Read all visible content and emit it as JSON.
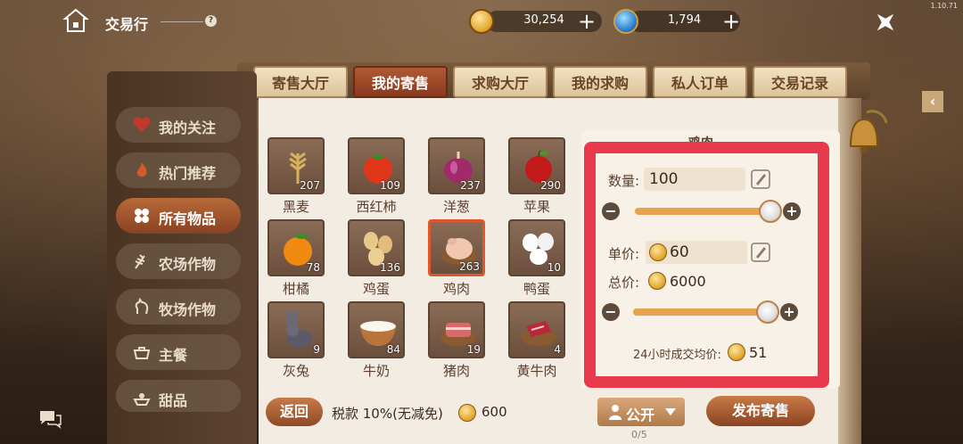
{
  "version": "1.10.71",
  "header": {
    "title": "交易行",
    "help": "?",
    "gold": {
      "amount": "30,254",
      "add": "+"
    },
    "gem": {
      "amount": "1,794",
      "add": "+"
    }
  },
  "tabs": [
    {
      "label": "寄售大厅"
    },
    {
      "label": "我的寄售"
    },
    {
      "label": "求购大厅"
    },
    {
      "label": "我的求购"
    },
    {
      "label": "私人订单"
    },
    {
      "label": "交易记录"
    }
  ],
  "categories": [
    {
      "label": "我的关注"
    },
    {
      "label": "热门推荐"
    },
    {
      "label": "所有物品"
    },
    {
      "label": "农场作物"
    },
    {
      "label": "牧场作物"
    },
    {
      "label": "主餐"
    },
    {
      "label": "甜品"
    }
  ],
  "items": [
    {
      "name": "黑麦",
      "count": "207"
    },
    {
      "name": "西红柿",
      "count": "109"
    },
    {
      "name": "洋葱",
      "count": "237"
    },
    {
      "name": "苹果",
      "count": "290"
    },
    {
      "name": "柑橘",
      "count": "78"
    },
    {
      "name": "鸡蛋",
      "count": "136"
    },
    {
      "name": "鸡肉",
      "count": "263"
    },
    {
      "name": "鸭蛋",
      "count": "10"
    },
    {
      "name": "灰兔",
      "count": "9"
    },
    {
      "name": "牛奶",
      "count": "84"
    },
    {
      "name": "猪肉",
      "count": "19"
    },
    {
      "name": "黄牛肉",
      "count": "4"
    }
  ],
  "detail": {
    "item_name": "鸡肉",
    "quantity_label": "数量:",
    "quantity_value": "100",
    "unit_price_label": "单价:",
    "unit_price_value": "60",
    "total_label": "总价:",
    "total_value": "6000",
    "avg_label": "24小时成交均价:",
    "avg_value": "51",
    "minus": "−",
    "plus": "+"
  },
  "footer": {
    "back": "返回",
    "tax": "税款 10%(无减免)",
    "tax_amount": "600",
    "visibility": "公开",
    "slots": "0/5",
    "publish": "发布寄售"
  },
  "colors": {
    "highlight_border": "#e83a4a",
    "active_tab": "#8a3a20",
    "slider": "#e6a24c"
  }
}
